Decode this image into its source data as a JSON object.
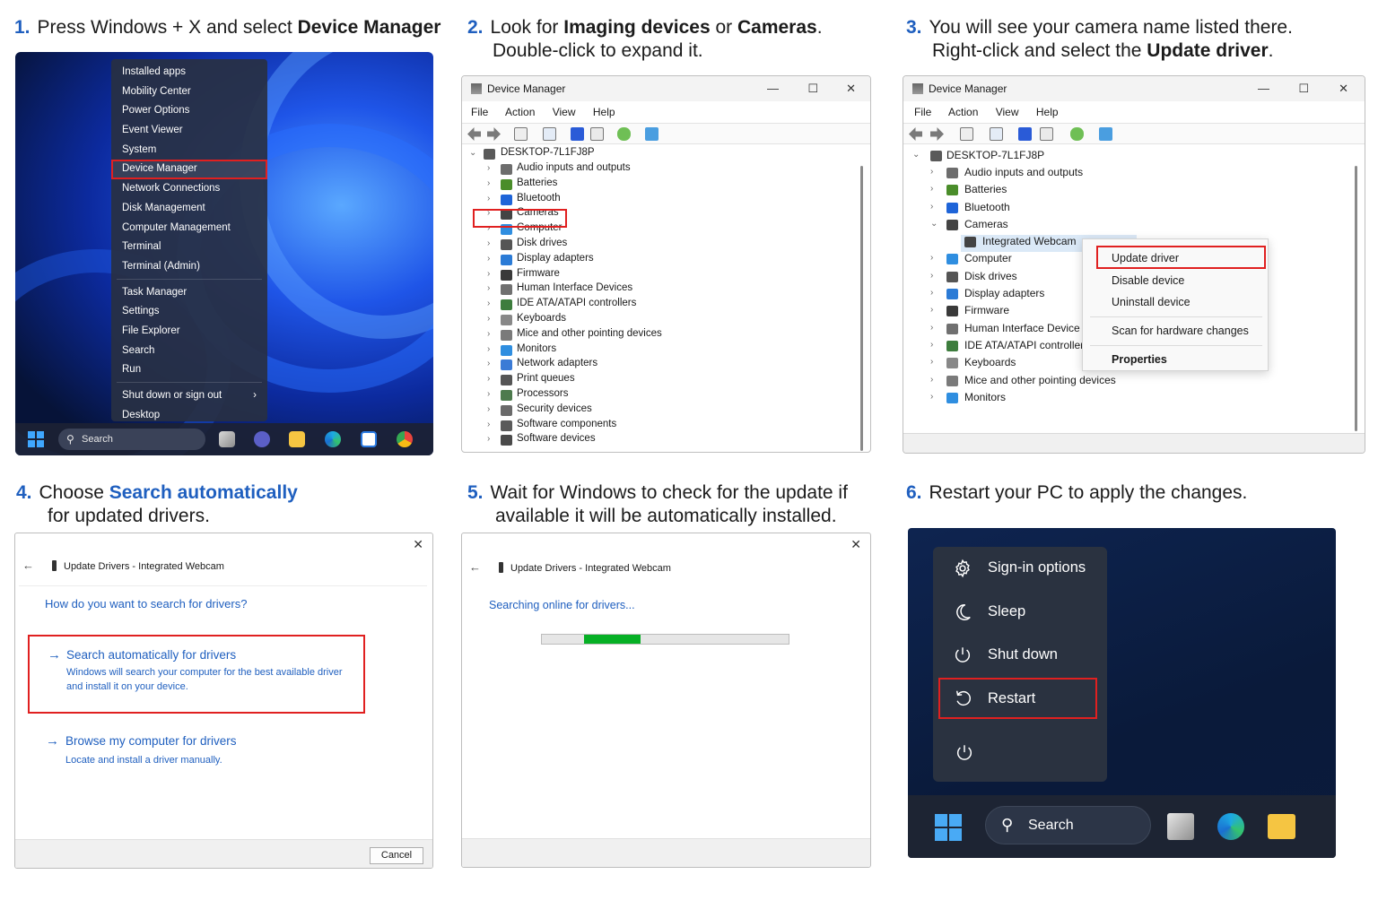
{
  "steps": [
    {
      "num": "1.",
      "pre": "Press Windows + X and select ",
      "bold": "Device Manager"
    },
    {
      "num": "2.",
      "pre": "Look for ",
      "bold1": "Imaging devices",
      "mid": " or ",
      "bold2": "Cameras",
      "post": ".",
      "line2": "Double-click to expand it."
    },
    {
      "num": "3.",
      "line1": "You will see your camera name listed there.",
      "pre2": "Right-click and select the ",
      "bold2": "Update driver",
      "post2": "."
    },
    {
      "num": "4.",
      "pre": "Choose ",
      "blue": "Search automatically",
      "line2": "for updated drivers."
    },
    {
      "num": "5.",
      "line1": "Wait for Windows to check for the update if",
      "line2": "available it will be automatically installed."
    },
    {
      "num": "6.",
      "line1": "Restart your PC to apply the changes."
    }
  ],
  "winx_menu": {
    "group1": [
      "Installed apps",
      "Mobility Center",
      "Power Options",
      "Event Viewer",
      "System",
      "Device Manager",
      "Network Connections",
      "Disk Management",
      "Computer Management",
      "Terminal",
      "Terminal (Admin)"
    ],
    "group2": [
      "Task Manager",
      "Settings",
      "File Explorer",
      "Search",
      "Run"
    ],
    "group3": [
      "Shut down or sign out",
      "Desktop"
    ],
    "highlighted": "Device Manager",
    "submenu_arrow": "›"
  },
  "taskbar_small": {
    "search_label": "Search"
  },
  "device_manager": {
    "title": "Device Manager",
    "menu": [
      "File",
      "Action",
      "View",
      "Help"
    ],
    "computer": "DESKTOP-7L1FJ8P",
    "categories_panel2": [
      "Audio inputs and outputs",
      "Batteries",
      "Bluetooth",
      "Cameras",
      "Computer",
      "Disk drives",
      "Display adapters",
      "Firmware",
      "Human Interface Devices",
      "IDE ATA/ATAPI controllers",
      "Keyboards",
      "Mice and other pointing devices",
      "Monitors",
      "Network adapters",
      "Print queues",
      "Processors",
      "Security devices",
      "Software components",
      "Software devices"
    ],
    "categories_panel3_before": [
      "Audio inputs and outputs",
      "Batteries",
      "Bluetooth",
      "Cameras"
    ],
    "webcam": "Integrated Webcam",
    "categories_panel3_after": [
      "Computer",
      "Disk drives",
      "Display adapters",
      "Firmware",
      "Human Interface Device",
      "IDE ATA/ATAPI controller",
      "Keyboards",
      "Mice and other pointing devices",
      "Monitors"
    ]
  },
  "context_menu": {
    "update": "Update driver",
    "disable": "Disable device",
    "uninstall": "Uninstall device",
    "scan": "Scan for hardware changes",
    "properties": "Properties"
  },
  "update_dialog": {
    "header": "Update Drivers - Integrated Webcam",
    "question": "How do you want to search for drivers?",
    "auto_title": "Search automatically for drivers",
    "auto_desc1": "Windows will search your computer for the best available driver",
    "auto_desc2": "and install it on your device.",
    "browse_title": "Browse my computer for drivers",
    "browse_desc": "Locate and install a driver manually.",
    "cancel": "Cancel",
    "searching": "Searching online for drivers...",
    "progress_fraction": 0.23
  },
  "power_menu": {
    "items": [
      "Sign-in options",
      "Sleep",
      "Shut down",
      "Restart"
    ],
    "highlighted": "Restart",
    "search_label": "Search"
  },
  "colors": {
    "accent_blue": "#1f5fbf",
    "highlight_red": "#e02020",
    "progress_green": "#06b025"
  }
}
